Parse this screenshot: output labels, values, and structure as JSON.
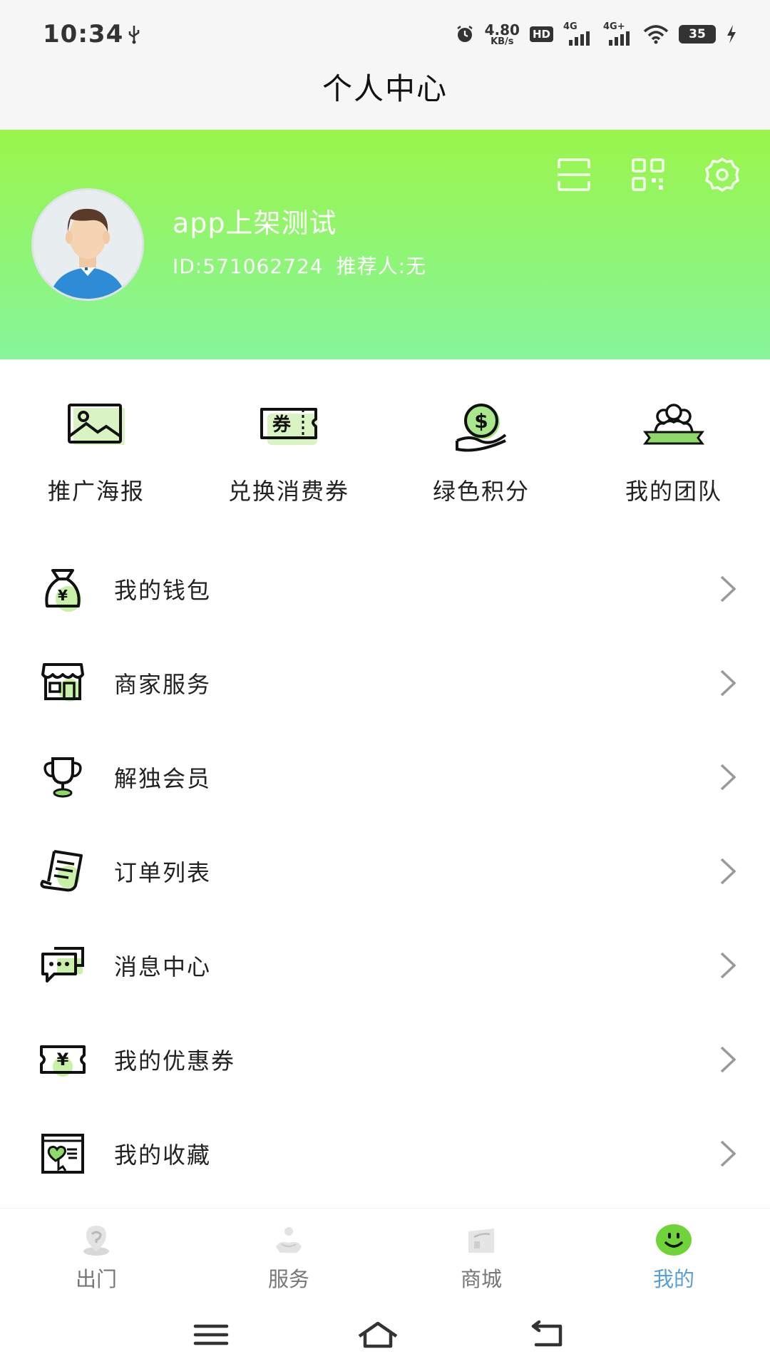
{
  "status_bar": {
    "time": "10:34",
    "net_speed_value": "4.80",
    "net_speed_unit": "KB/s",
    "hd_label": "HD",
    "sim1_label": "4G",
    "sim2_label": "4G+",
    "battery_level": "35"
  },
  "header": {
    "title": "个人中心"
  },
  "profile": {
    "name": "app上架测试",
    "id_text": "ID:571062724",
    "referrer_text": "推荐人:无"
  },
  "quick_actions": [
    {
      "label": "推广海报",
      "icon": "image-icon"
    },
    {
      "label": "兑换消费券",
      "icon": "voucher-icon"
    },
    {
      "label": "绿色积分",
      "icon": "coin-hand-icon"
    },
    {
      "label": "我的团队",
      "icon": "team-icon"
    }
  ],
  "menu": [
    {
      "label": "我的钱包",
      "icon": "money-bag-icon"
    },
    {
      "label": "商家服务",
      "icon": "shop-icon"
    },
    {
      "label": "解独会员",
      "icon": "trophy-icon"
    },
    {
      "label": "订单列表",
      "icon": "receipt-icon"
    },
    {
      "label": "消息中心",
      "icon": "chat-icon"
    },
    {
      "label": "我的优惠券",
      "icon": "coupon-icon"
    },
    {
      "label": "我的收藏",
      "icon": "favorite-icon"
    }
  ],
  "bottom_nav": [
    {
      "label": "出门",
      "icon": "location-icon",
      "active": false
    },
    {
      "label": "服务",
      "icon": "service-icon",
      "active": false
    },
    {
      "label": "商城",
      "icon": "store-icon",
      "active": false
    },
    {
      "label": "我的",
      "icon": "smiley-icon",
      "active": true
    }
  ],
  "colors": {
    "banner_top": "#9af54a",
    "banner_bottom": "#86f59c",
    "accent_green": "#9be46a",
    "active_tab": "#5a9fd6"
  }
}
